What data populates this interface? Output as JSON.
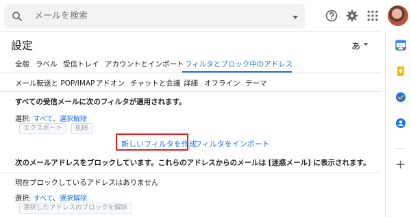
{
  "header": {
    "search_placeholder": "メールを検索",
    "icons": [
      "search-icon",
      "dropdown-caret-icon",
      "help-icon",
      "settings-gear-icon",
      "apps-grid-icon",
      "account-avatar"
    ]
  },
  "settings": {
    "title": "設定",
    "language_indicator": "あ",
    "tabs_row1": [
      "全般",
      "ラベル",
      "受信トレイ",
      "アカウントとインポート",
      "フィルタとブロック中のアドレス"
    ],
    "tabs_row2": [
      "メール転送と POP/IMAP",
      "アドオン",
      "チャットと会議",
      "詳細",
      "オフライン",
      "テーマ"
    ],
    "active_tab": "フィルタとブロック中のアドレス"
  },
  "filters": {
    "heading": "すべての受信メールに次のフィルタが適用されます。",
    "select_label": "選択: ",
    "select_all": "すべて",
    "select_sep": "、",
    "select_none": "選択解除",
    "export_button": "エクスポート",
    "delete_button": "削除",
    "new_filter_link": "新しいフィルタを作成",
    "import_link": "フィルタをインポート"
  },
  "blocked": {
    "heading": "次のメールアドレスをブロックしています。これらのアドレスからのメールは [迷惑メール] に表示されます。",
    "empty_text": "現在ブロックしているアドレスはありません",
    "select_label": "選択: ",
    "select_all": "すべて",
    "select_sep": "、",
    "select_none": "選択解除",
    "unblock_button": "選択したアドレスのブロックを解除"
  },
  "side_panel": {
    "icons": [
      "calendar-icon",
      "keep-icon",
      "tasks-icon",
      "contacts-icon",
      "add-icon"
    ],
    "plus_glyph": "+"
  },
  "colors": {
    "accent": "#1a73e8",
    "highlight_box": "#e02020",
    "text": "#202124",
    "muted": "#5f6368"
  }
}
